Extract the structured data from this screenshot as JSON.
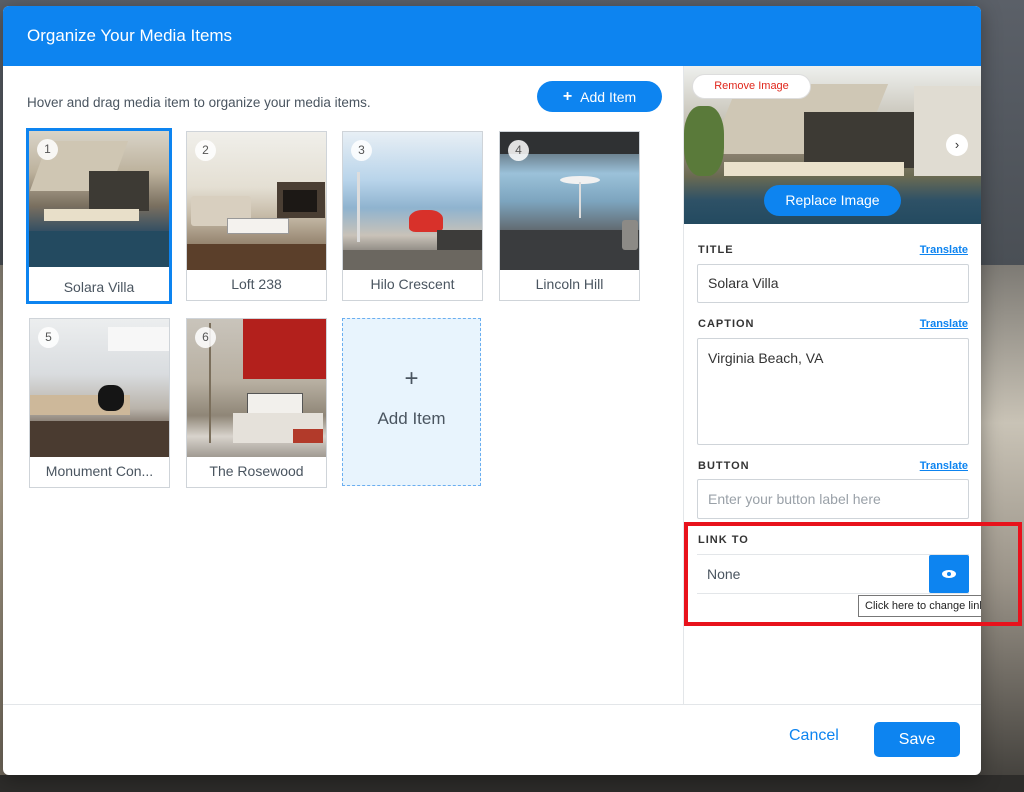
{
  "modal": {
    "title": "Organize Your Media Items",
    "hint": "Hover and drag media item to organize your media items.",
    "add_item_button": "Add Item",
    "add_item_plus": "+",
    "add_tile_label": "Add Item",
    "add_tile_plus": "+"
  },
  "media_items": [
    {
      "number": "1",
      "label": "Solara Villa",
      "selected": true
    },
    {
      "number": "2",
      "label": "Loft 238"
    },
    {
      "number": "3",
      "label": "Hilo Crescent"
    },
    {
      "number": "4",
      "label": "Lincoln Hill"
    },
    {
      "number": "5",
      "label": "Monument Con..."
    },
    {
      "number": "6",
      "label": "The Rosewood"
    }
  ],
  "editor": {
    "remove_image": "Remove Image",
    "replace_image": "Replace Image",
    "next_icon": "chevron-right-icon",
    "title_label": "TITLE",
    "title_value": "Solara Villa",
    "caption_label": "CAPTION",
    "caption_value": "Virginia Beach, VA",
    "button_label": "BUTTON",
    "button_placeholder": "Enter your button label here",
    "translate": "Translate",
    "link_to_label": "LINK TO",
    "link_to_value": "None",
    "link_icon": "eye-icon",
    "tooltip": "Click here to change link to"
  },
  "footer": {
    "cancel": "Cancel",
    "save": "Save"
  },
  "colors": {
    "accent": "#0d84f0",
    "highlight": "#e8121c",
    "danger": "#e0271c"
  }
}
